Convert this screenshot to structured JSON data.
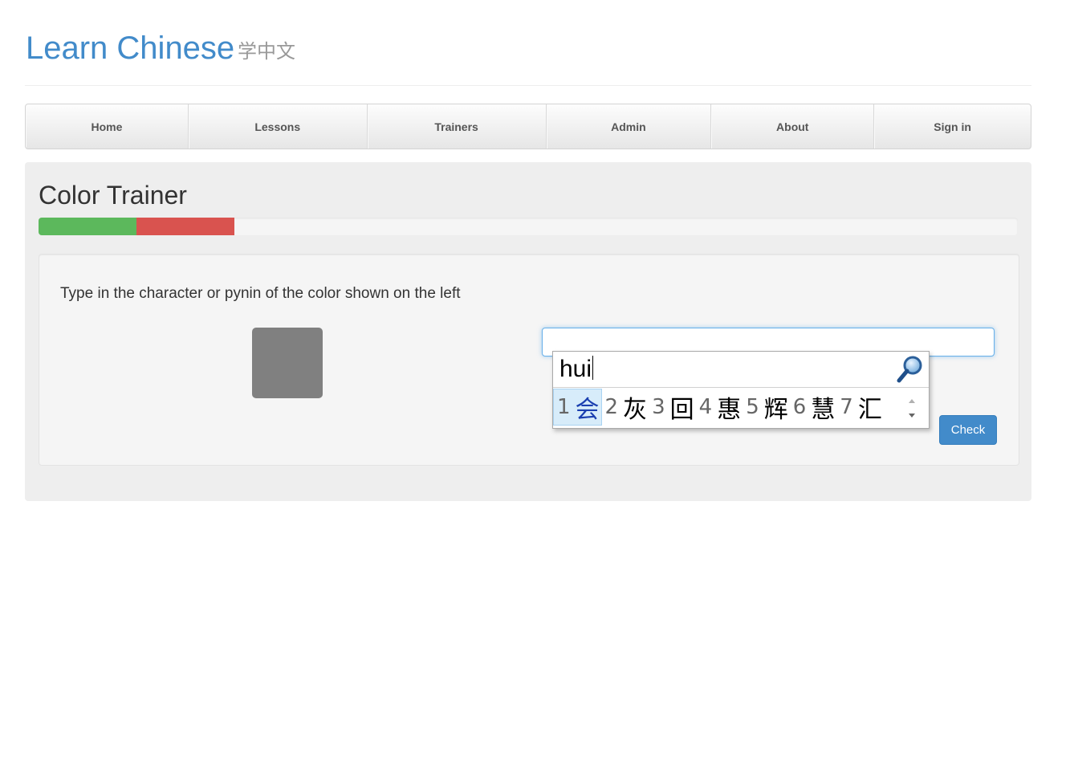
{
  "header": {
    "brand": "Learn Chinese",
    "brand_sub": "学中文"
  },
  "nav": {
    "items": [
      {
        "label": "Home"
      },
      {
        "label": "Lessons"
      },
      {
        "label": "Trainers"
      },
      {
        "label": "Admin"
      },
      {
        "label": "About"
      },
      {
        "label": "Sign in"
      }
    ]
  },
  "trainer": {
    "title": "Color Trainer",
    "progress": {
      "correct_fraction": 0.1,
      "wrong_fraction": 0.1,
      "correct_color": "#5cb85c",
      "wrong_color": "#d9534f"
    },
    "instructions": "Type in the character or pynin of the color shown on the left",
    "swatch_color": "#808080",
    "input_value": "",
    "check_label": "Check"
  },
  "ime": {
    "composition": "hui",
    "candidates": [
      {
        "num": "1",
        "char": "会"
      },
      {
        "num": "2",
        "char": "灰"
      },
      {
        "num": "3",
        "char": "回"
      },
      {
        "num": "4",
        "char": "惠"
      },
      {
        "num": "5",
        "char": "辉"
      },
      {
        "num": "6",
        "char": "慧"
      },
      {
        "num": "7",
        "char": "汇"
      }
    ],
    "search_icon": "magnifier-icon",
    "scroll_icon": "scroll-arrows-icon"
  }
}
